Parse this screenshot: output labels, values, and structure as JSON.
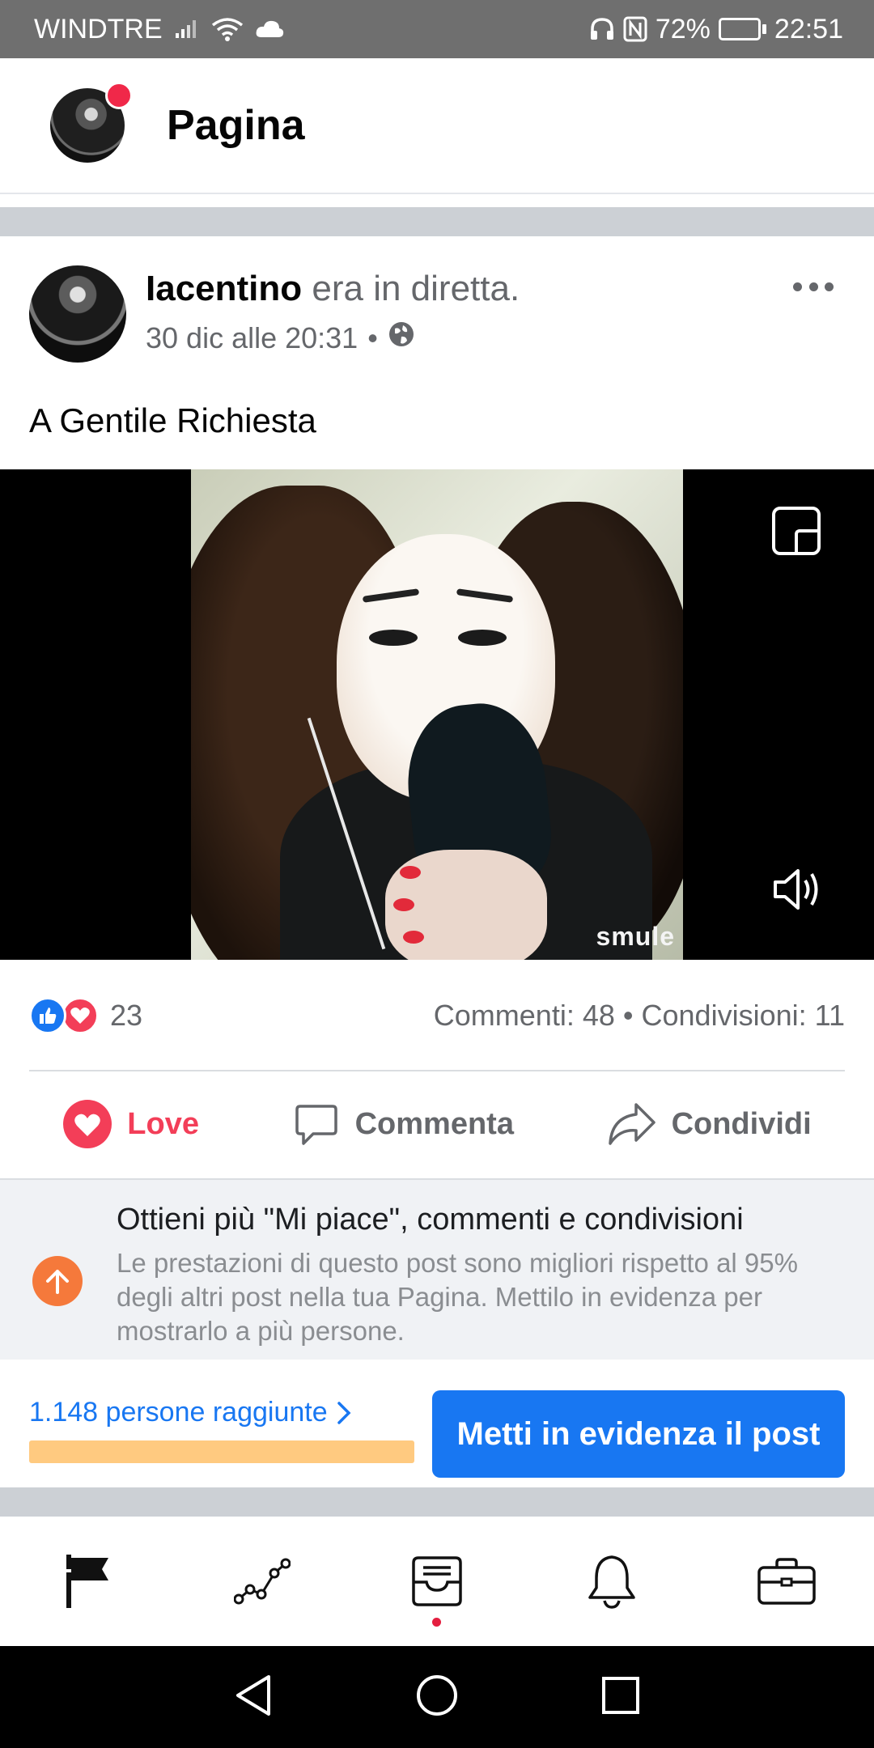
{
  "status_bar": {
    "carrier": "WINDTRE",
    "battery": "72%",
    "battery_level": 0.72,
    "time": "22:51"
  },
  "header": {
    "title": "Pagina"
  },
  "post": {
    "author": "Iacentino",
    "action": "era in diretta.",
    "date": "30 dic alle 20:31",
    "privacy_separator": "•",
    "text": "A Gentile Richiesta",
    "video_watermark": "smule"
  },
  "reactions": {
    "count": "23",
    "comments": "Commenti: 48",
    "separator": "•",
    "shares": "Condivisioni: 11"
  },
  "actions": {
    "love": "Love",
    "comment": "Commenta",
    "share": "Condividi"
  },
  "boost": {
    "title": "Ottieni più \"Mi piace\", commenti e condivisioni",
    "description": "Le prestazioni di questo post sono migliori rispetto al 95% degli altri post nella tua Pagina. Mettilo in evidenza per mostrarlo a più persone.",
    "reach": "1.148 persone raggiunte",
    "button": "Metti in evidenza il post"
  },
  "colors": {
    "brand_blue": "#1877f2",
    "love_red": "#f33e58",
    "boost_orange": "#f5793b",
    "reach_bar": "#ffca80"
  }
}
